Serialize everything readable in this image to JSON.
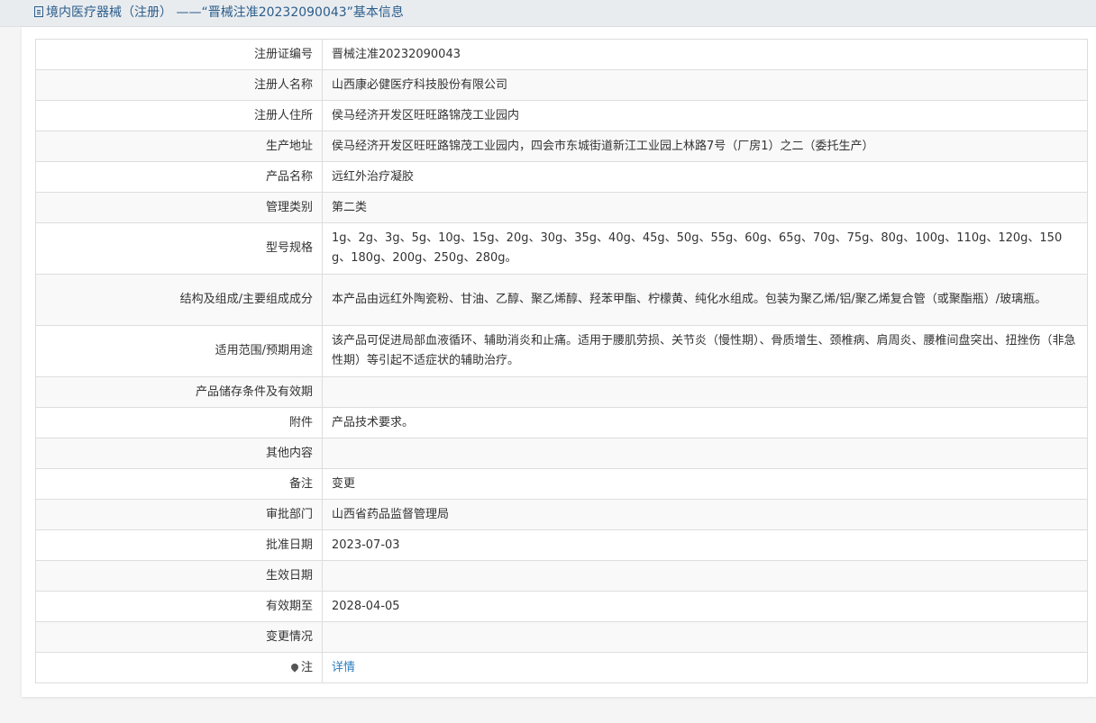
{
  "header": {
    "title": "境内医疗器械（注册） ——“晋械注准20232090043”基本信息"
  },
  "rows": [
    {
      "label": "注册证编号",
      "value": "晋械注准20232090043"
    },
    {
      "label": "注册人名称",
      "value": "山西康必健医疗科技股份有限公司"
    },
    {
      "label": "注册人住所",
      "value": "侯马经济开发区旺旺路锦茂工业园内"
    },
    {
      "label": "生产地址",
      "value": "侯马经济开发区旺旺路锦茂工业园内，四会市东城街道新江工业园上林路7号（厂房1）之二（委托生产）"
    },
    {
      "label": "产品名称",
      "value": "远红外治疗凝胶"
    },
    {
      "label": "管理类别",
      "value": "第二类"
    },
    {
      "label": "型号规格",
      "value": "1g、2g、3g、5g、10g、15g、20g、30g、35g、40g、45g、50g、55g、60g、65g、70g、75g、80g、100g、110g、120g、150g、180g、200g、250g、280g。"
    },
    {
      "label": "结构及组成/主要组成成分",
      "value": "本产品由远红外陶瓷粉、甘油、乙醇、聚乙烯醇、羟苯甲酯、柠檬黄、纯化水组成。包装为聚乙烯/铝/聚乙烯复合管（或聚酯瓶）/玻璃瓶。"
    },
    {
      "label": "适用范围/预期用途",
      "value": "该产品可促进局部血液循环、辅助消炎和止痛。适用于腰肌劳损、关节炎（慢性期）、骨质增生、颈椎病、肩周炎、腰椎间盘突出、扭挫伤（非急性期）等引起不适症状的辅助治疗。"
    },
    {
      "label": "产品储存条件及有效期",
      "value": ""
    },
    {
      "label": "附件",
      "value": "产品技术要求。"
    },
    {
      "label": "其他内容",
      "value": ""
    },
    {
      "label": "备注",
      "value": "变更"
    },
    {
      "label": "审批部门",
      "value": "山西省药品监督管理局"
    },
    {
      "label": "批准日期",
      "value": "2023-07-03"
    },
    {
      "label": "生效日期",
      "value": ""
    },
    {
      "label": "有效期至",
      "value": "2028-04-05"
    },
    {
      "label": "变更情况",
      "value": ""
    }
  ],
  "note": {
    "label": "注",
    "icon": "pin-icon",
    "link_text": "详情"
  }
}
